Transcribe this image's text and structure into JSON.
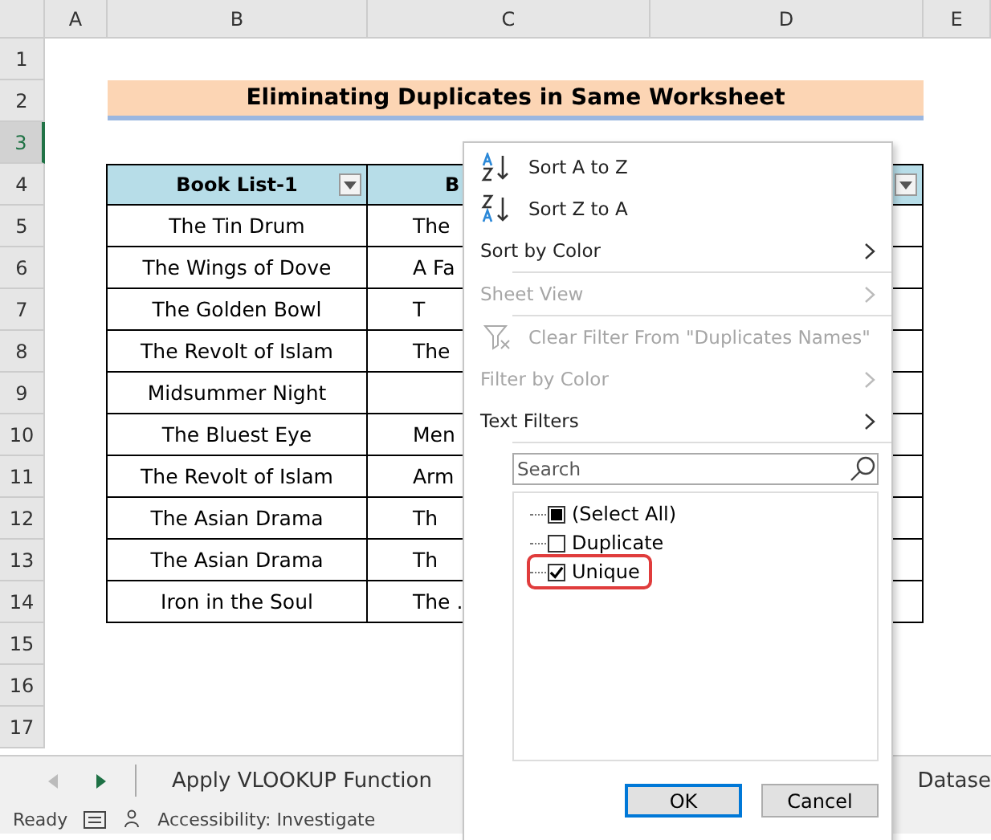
{
  "columns": [
    "A",
    "B",
    "C",
    "D",
    "E"
  ],
  "rows": [
    {
      "label": "1",
      "selected": false
    },
    {
      "label": "2",
      "selected": false
    },
    {
      "label": "3",
      "selected": true
    },
    {
      "label": "4",
      "selected": false
    },
    {
      "label": "5",
      "selected": false
    },
    {
      "label": "6",
      "selected": false
    },
    {
      "label": "7",
      "selected": false
    },
    {
      "label": "8",
      "selected": false
    },
    {
      "label": "9",
      "selected": false
    },
    {
      "label": "10",
      "selected": false
    },
    {
      "label": "11",
      "selected": false
    },
    {
      "label": "12",
      "selected": false
    },
    {
      "label": "13",
      "selected": false
    },
    {
      "label": "14",
      "selected": false
    },
    {
      "label": "15",
      "selected": false
    },
    {
      "label": "16",
      "selected": false
    },
    {
      "label": "17",
      "selected": false
    }
  ],
  "title": "Eliminating Duplicates in Same Worksheet",
  "table": {
    "header": [
      {
        "label": "Book List-1",
        "filter": true
      },
      {
        "label": "B",
        "filter": false
      },
      {
        "filter": true
      }
    ],
    "rows": [
      [
        "The Tin Drum",
        "The"
      ],
      [
        "The Wings of Dove",
        "A Fa"
      ],
      [
        "The Golden Bowl",
        "T"
      ],
      [
        "The Revolt of Islam",
        "The"
      ],
      [
        "Midsummer Night",
        ""
      ],
      [
        "The Bluest Eye",
        "Men"
      ],
      [
        "The Revolt of Islam",
        "Arm"
      ],
      [
        "The Asian Drama",
        "Th"
      ],
      [
        "The Asian Drama",
        "Th"
      ],
      [
        "Iron in the Soul",
        "The ."
      ]
    ]
  },
  "sheet_tabs": [
    {
      "label": "Apply VLOOKUP Function",
      "selected": false
    },
    {
      "label": "Datase",
      "selected": false
    }
  ],
  "status_bar": {
    "ready": "Ready",
    "accessibility": "Accessibility: Investigate"
  },
  "filter_menu": {
    "items": [
      {
        "kind": "sort-az",
        "label": "Sort A to Z",
        "disabled": false
      },
      {
        "kind": "sort-za",
        "label": "Sort Z to A",
        "disabled": false
      },
      {
        "kind": "submenu",
        "label": "Sort by Color",
        "disabled": false
      },
      {
        "kind": "separator"
      },
      {
        "kind": "submenu",
        "label": "Sheet View",
        "disabled": true
      },
      {
        "kind": "separator"
      },
      {
        "kind": "clear",
        "label": "Clear Filter From \"Duplicates Names\"",
        "disabled": true
      },
      {
        "kind": "submenu",
        "label": "Filter by Color",
        "disabled": true
      },
      {
        "kind": "submenu",
        "label": "Text Filters",
        "disabled": false
      },
      {
        "kind": "separator"
      }
    ],
    "search": {
      "placeholder": "Search"
    },
    "values": [
      {
        "label": "(Select All)",
        "checked": false,
        "partial": true,
        "highlighted": false
      },
      {
        "label": "Duplicate",
        "checked": false,
        "partial": false,
        "highlighted": false
      },
      {
        "label": "Unique",
        "checked": true,
        "partial": false,
        "highlighted": true
      }
    ],
    "buttons": [
      {
        "label": "OK",
        "selected": true
      },
      {
        "label": "Cancel",
        "selected": false
      }
    ]
  }
}
